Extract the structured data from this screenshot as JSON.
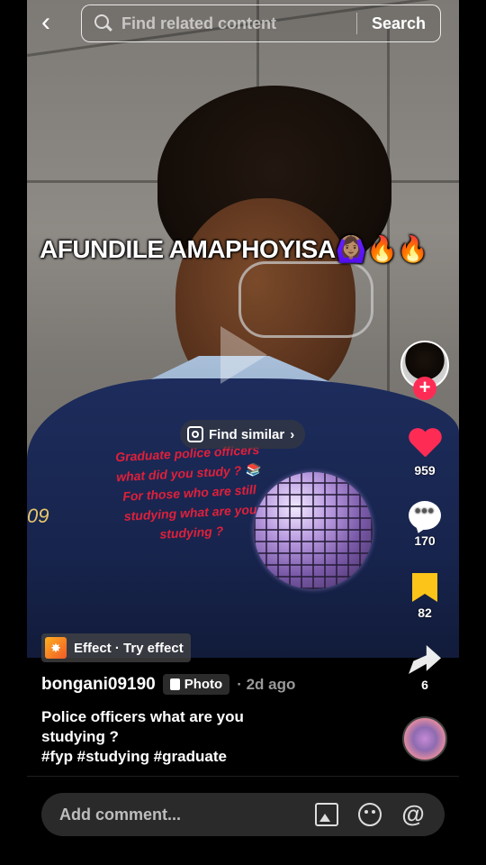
{
  "top_bar": {
    "search_placeholder": "Find related content",
    "search_button": "Search"
  },
  "media": {
    "overlay_title": "AFUNDILE AMAPHOYISA🙆🏽‍♀️🔥🔥",
    "red_caption": "Graduate police officers\nwhat did you study ? 📚\nFor those who are still\nstudying what are you\nstudying ?",
    "uniform_number": "09",
    "find_similar": "Find similar",
    "effect_label": "Effect · Try effect"
  },
  "rail": {
    "follow_symbol": "+",
    "likes": "959",
    "comments": "170",
    "saves": "82",
    "shares": "6"
  },
  "post": {
    "username": "bongani09190",
    "type_badge": "Photo",
    "time_ago": "· 2d ago",
    "caption": "Police officers what are you studying ?",
    "hashtags": "#fyp #studying #graduate"
  },
  "comment_bar": {
    "placeholder": "Add comment..."
  },
  "colors": {
    "like_red": "#fe2c55",
    "bookmark_yellow": "#fcc419",
    "caption_red": "#e0203a"
  }
}
